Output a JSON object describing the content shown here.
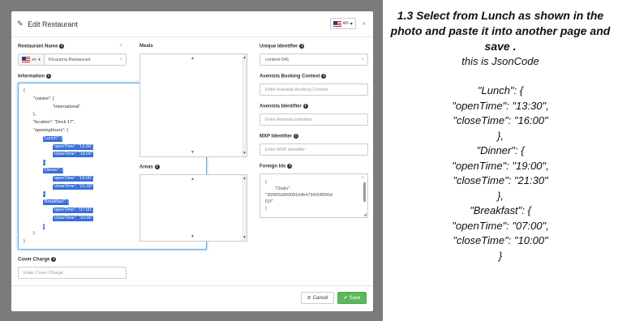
{
  "modal": {
    "title": "Edit Restaurant",
    "lang": "en",
    "close": "×"
  },
  "fields": {
    "restaurant_name_label": "Restaurant Name",
    "restaurant_name_lang": "en",
    "restaurant_name_value": "Khuzama Restaurant",
    "information_label": "Information",
    "meals_label": "Meals",
    "areas_label": "Areas",
    "cover_charge_label": "Cover Charge",
    "cover_charge_placeholder": "Enter Cover Charge",
    "unique_identifier_label": "Unique Identifier",
    "unique_identifier_value": "content-545",
    "avenista_booking_label": "Avenista Booking Context",
    "avenista_booking_placeholder": "Enter Avenista Booking Context",
    "avenista_identifier_label": "Avenista Identifier",
    "avenista_identifier_placeholder": "Enter Avenista Identifier",
    "mxp_identifier_label": "MXP Identifier",
    "mxp_identifier_placeholder": "Enter MXP Identifier",
    "foreign_ids_label": "Foreign Ids",
    "foreign_ids_lines": [
      "{",
      "\"Otalio\":",
      "\"35f965d900081fefb479490f9f90d",
      "01f\"",
      "}"
    ]
  },
  "json_editor": {
    "lines": [
      {
        "text": "{",
        "indent": 0,
        "selected": false
      },
      {
        "text": "\"cuisine\": [",
        "indent": 1,
        "selected": false
      },
      {
        "text": "\"International\"",
        "indent": 3,
        "selected": false
      },
      {
        "text": "],",
        "indent": 1,
        "selected": false
      },
      {
        "text": "\"location\": \"Deck 17\",",
        "indent": 1,
        "selected": false
      },
      {
        "text": "\"openingHours\": {",
        "indent": 1,
        "selected": false
      },
      {
        "text": "\"Lunch\": {",
        "indent": 2,
        "selected": true
      },
      {
        "text": "\"openTime\": \"13:30\",",
        "indent": 3,
        "selected": true
      },
      {
        "text": "\"closeTime\": \"16:00\"",
        "indent": 3,
        "selected": true
      },
      {
        "text": "},",
        "indent": 2,
        "selected": true
      },
      {
        "text": "\"Dinner\": {",
        "indent": 2,
        "selected": true
      },
      {
        "text": "\"openTime\": \"19:00\",",
        "indent": 3,
        "selected": true
      },
      {
        "text": "\"closeTime\": \"21:30\"",
        "indent": 3,
        "selected": true
      },
      {
        "text": "},",
        "indent": 2,
        "selected": true
      },
      {
        "text": "\"Breakfast\": {",
        "indent": 2,
        "selected": true
      },
      {
        "text": "\"openTime\": \"07:00\",",
        "indent": 3,
        "selected": true
      },
      {
        "text": "\"closeTime\": \"10:00\"",
        "indent": 3,
        "selected": true
      },
      {
        "text": "}",
        "indent": 2,
        "selected": true
      },
      {
        "text": "}",
        "indent": 1,
        "selected": false
      },
      {
        "text": "}",
        "indent": 0,
        "selected": false
      }
    ]
  },
  "footer": {
    "cancel_label": "Cancel",
    "save_label": "Save"
  },
  "instructions": {
    "title": "1.3 Select from Lunch  as shown in the photo and paste it into another page and save .",
    "subtitle": "this is JsonCode",
    "code_lines": [
      "\"Lunch\": {",
      "\"openTime\": \"13:30\",",
      "\"closeTime\": \"16:00\"",
      "},",
      "\"Dinner\": {",
      "\"openTime\": \"19:00\",",
      "\"closeTime\": \"21:30\"",
      "},",
      "\"Breakfast\": {",
      "\"openTime\": \"07:00\",",
      "\"closeTime\": \"10:00\"",
      "}"
    ]
  }
}
